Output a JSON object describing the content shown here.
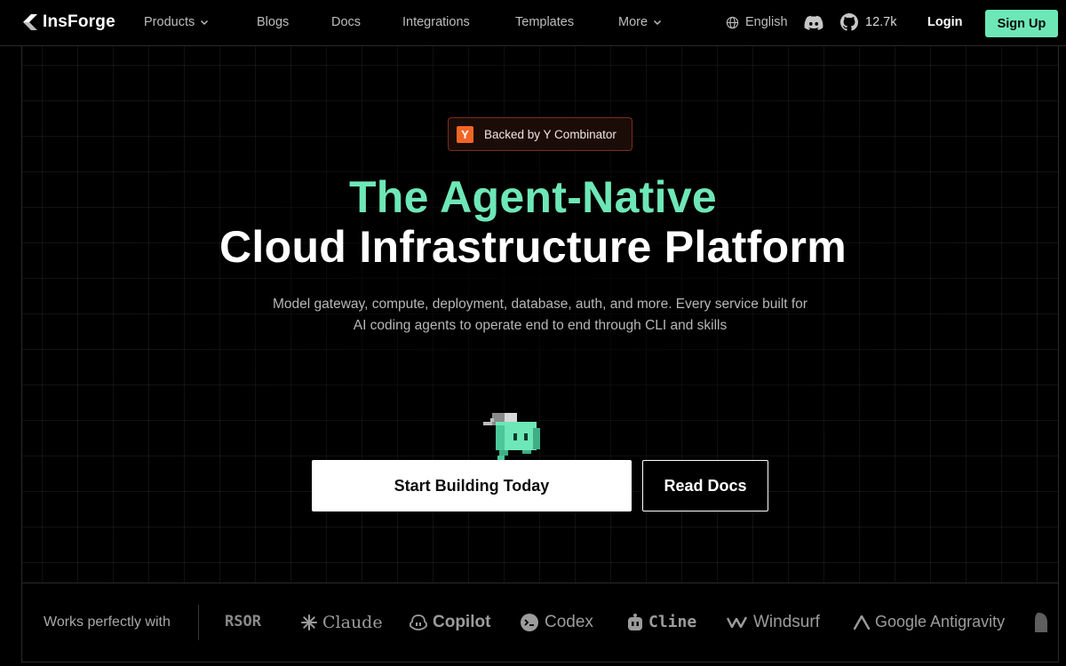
{
  "nav": {
    "brand": "InsForge",
    "links": [
      {
        "label": "Products",
        "has_dropdown": true
      },
      {
        "label": "Blogs",
        "has_dropdown": false
      },
      {
        "label": "Docs",
        "has_dropdown": false
      },
      {
        "label": "Integrations",
        "has_dropdown": false
      },
      {
        "label": "Templates",
        "has_dropdown": false
      },
      {
        "label": "More",
        "has_dropdown": true
      }
    ],
    "language": "English",
    "github_stars": "12.7k",
    "login": "Login",
    "signup": "Sign Up"
  },
  "hero": {
    "badge_icon": "Y",
    "badge_text": "Backed by Y Combinator",
    "title_line1": "The Agent-Native",
    "title_line2": "Cloud Infrastructure Platform",
    "subtitle_line1": "Model gateway, compute, deployment, database, auth, and more. Every service built for",
    "subtitle_line2": "AI coding agents to operate end to end through CLI and skills",
    "cta_primary": "Start Building Today",
    "cta_secondary": "Read Docs"
  },
  "partners": {
    "label": "Works perfectly with",
    "items": [
      {
        "name": "RSOR",
        "icon": "cursor-icon"
      },
      {
        "name": "Claude",
        "icon": "claude-icon"
      },
      {
        "name": "Copilot",
        "icon": "copilot-icon"
      },
      {
        "name": "Codex",
        "icon": "codex-icon"
      },
      {
        "name": "Cline",
        "icon": "cline-icon"
      },
      {
        "name": "Windsurf",
        "icon": "windsurf-icon"
      },
      {
        "name": "Google Antigravity",
        "icon": "antigravity-icon"
      }
    ]
  },
  "colors": {
    "accent": "#6ee7b7",
    "background": "#000000",
    "yc_orange": "#f26625"
  }
}
